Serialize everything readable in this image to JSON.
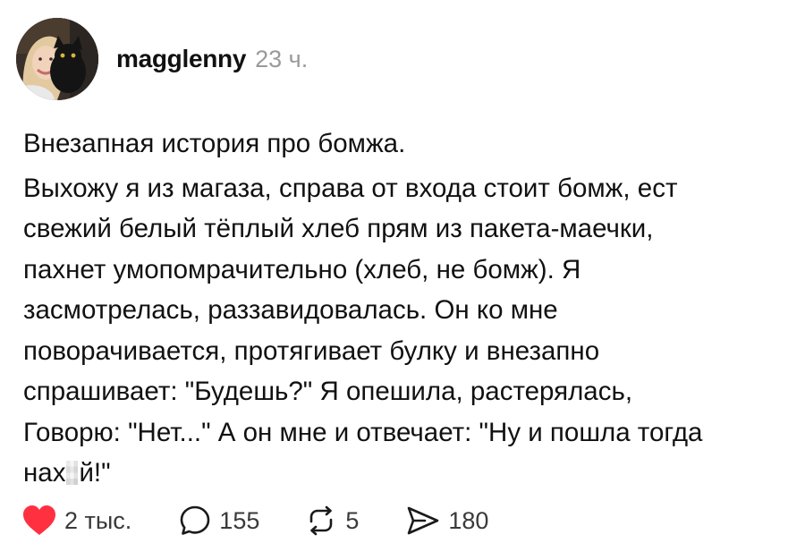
{
  "post": {
    "author": {
      "username": "magglenny",
      "timestamp": "23 ч."
    },
    "title": "Внезапная история про бомжа.",
    "lines": [
      "Выхожу я из магаза, справа от входа стоит бомж, ест",
      "свежий белый тёплый хлеб прям из пакета-маечки,",
      "пахнет умопомрачительно (хлеб, не бомж). Я",
      "засмотрелась, раззавидовалась. Он ко мне",
      "поворачивается, протягивает булку и внезапно",
      "спрашивает: \"Будешь?\" Я опешила, растерялась,",
      "Говорю: \"Нет...\" А он мне и отвечает: \"Ну и пошла тогда"
    ],
    "last_line": {
      "before": "нах",
      "after": "й!\""
    }
  },
  "actions": {
    "likes": "2 тыс.",
    "comments": "155",
    "reposts": "5",
    "shares": "180"
  },
  "colors": {
    "like": "#ff3040",
    "text": "#111111",
    "muted": "#9a9a9a"
  },
  "icons": {
    "like": "heart-icon",
    "comment": "comment-icon",
    "repost": "repost-icon",
    "share": "send-icon"
  }
}
